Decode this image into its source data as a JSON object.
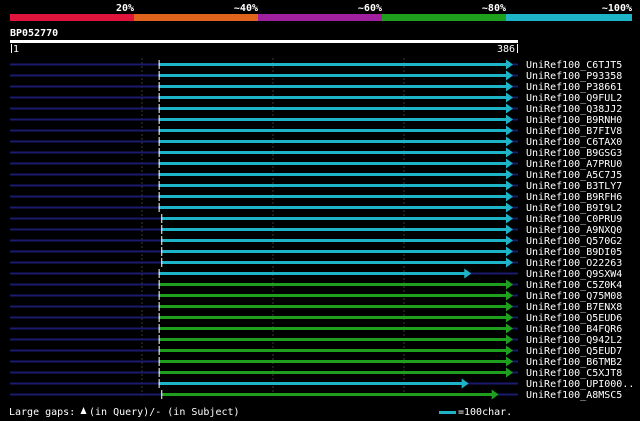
{
  "identity_scale": {
    "labels": [
      "20%",
      "~40%",
      "~60%",
      "~80%",
      "~100%"
    ],
    "colors": [
      "#e0143c",
      "#e0641e",
      "#a020a0",
      "#1ea01e",
      "#1eb4c8"
    ]
  },
  "query": {
    "name": "BP052770",
    "start_label": "1",
    "end_label": "386",
    "length": 386
  },
  "guide_color": "#1a1a6e",
  "hits": [
    {
      "name": "UniRef100_C6TJT5",
      "start": 115,
      "end": 386,
      "color": "#1eb4c8"
    },
    {
      "name": "UniRef100_P93358",
      "start": 115,
      "end": 386,
      "color": "#1eb4c8"
    },
    {
      "name": "UniRef100_P38661",
      "start": 115,
      "end": 386,
      "color": "#1eb4c8"
    },
    {
      "name": "UniRef100_Q9FUL2",
      "start": 115,
      "end": 386,
      "color": "#1eb4c8"
    },
    {
      "name": "UniRef100_Q38JJ2",
      "start": 115,
      "end": 386,
      "color": "#1eb4c8"
    },
    {
      "name": "UniRef100_B9RNH0",
      "start": 115,
      "end": 386,
      "color": "#1eb4c8"
    },
    {
      "name": "UniRef100_B7FIV8",
      "start": 115,
      "end": 386,
      "color": "#1eb4c8"
    },
    {
      "name": "UniRef100_C6TAX0",
      "start": 115,
      "end": 386,
      "color": "#1eb4c8"
    },
    {
      "name": "UniRef100_B9GSG3",
      "start": 115,
      "end": 386,
      "color": "#1eb4c8"
    },
    {
      "name": "UniRef100_A7PRU0",
      "start": 115,
      "end": 386,
      "color": "#1eb4c8"
    },
    {
      "name": "UniRef100_A5C7J5",
      "start": 115,
      "end": 386,
      "color": "#1eb4c8"
    },
    {
      "name": "UniRef100_B3TLY7",
      "start": 115,
      "end": 386,
      "color": "#1eb4c8"
    },
    {
      "name": "UniRef100_B9RFH6",
      "start": 115,
      "end": 386,
      "color": "#1eb4c8"
    },
    {
      "name": "UniRef100_B9I9L2",
      "start": 115,
      "end": 386,
      "color": "#1eb4c8"
    },
    {
      "name": "UniRef100_C0PRU9",
      "start": 117,
      "end": 386,
      "color": "#1eb4c8"
    },
    {
      "name": "UniRef100_A9NXQ0",
      "start": 117,
      "end": 386,
      "color": "#1eb4c8"
    },
    {
      "name": "UniRef100_Q570G2",
      "start": 117,
      "end": 386,
      "color": "#1eb4c8"
    },
    {
      "name": "UniRef100_B9DI05",
      "start": 117,
      "end": 386,
      "color": "#1eb4c8"
    },
    {
      "name": "UniRef100_O22263",
      "start": 117,
      "end": 386,
      "color": "#1eb4c8"
    },
    {
      "name": "UniRef100_Q9SXW4",
      "start": 115,
      "end": 354,
      "color": "#1eb4c8"
    },
    {
      "name": "UniRef100_C5Z0K4",
      "start": 115,
      "end": 386,
      "color": "#1ea01e"
    },
    {
      "name": "UniRef100_Q75M08",
      "start": 115,
      "end": 386,
      "color": "#1ea01e"
    },
    {
      "name": "UniRef100_B7ENX8",
      "start": 115,
      "end": 386,
      "color": "#1ea01e"
    },
    {
      "name": "UniRef100_Q5EUD6",
      "start": 115,
      "end": 386,
      "color": "#1ea01e"
    },
    {
      "name": "UniRef100_B4FQR6",
      "start": 115,
      "end": 386,
      "color": "#1ea01e"
    },
    {
      "name": "UniRef100_Q942L2",
      "start": 115,
      "end": 386,
      "color": "#1ea01e"
    },
    {
      "name": "UniRef100_Q5EUD7",
      "start": 115,
      "end": 386,
      "color": "#1ea01e"
    },
    {
      "name": "UniRef100_B6TMB2",
      "start": 115,
      "end": 386,
      "color": "#1ea01e"
    },
    {
      "name": "UniRef100_C5XJT8",
      "start": 115,
      "end": 386,
      "color": "#1ea01e"
    },
    {
      "name": "UniRef100_UPI000..",
      "start": 115,
      "end": 352,
      "color": "#1eb4c8"
    },
    {
      "name": "UniRef100_A8MSC5",
      "start": 117,
      "end": 375,
      "color": "#1ea01e"
    }
  ],
  "footer": {
    "gaps_prefix": "Large gaps:",
    "gaps_query": "(in Query)",
    "gaps_separator": "/",
    "gaps_subject": "- (in Subject)",
    "scale_text": "=100char."
  }
}
